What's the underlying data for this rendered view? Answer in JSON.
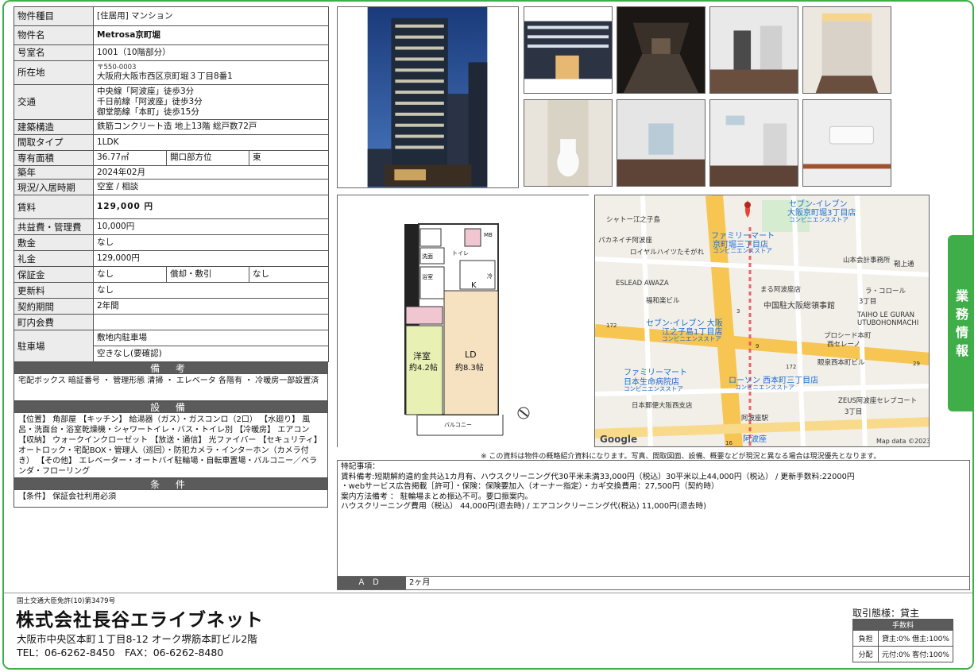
{
  "property": {
    "type_label": "物件種目",
    "type_value": "[住居用] マンション",
    "name_label": "物件名",
    "name_value": "Metrosa京町堀",
    "room_label": "号室名",
    "room_value": "1001（10階部分）",
    "address_label": "所在地",
    "postal": "〒550-0003",
    "address_value": "大阪府大阪市西区京町堀３丁目8番1",
    "transit_label": "交通",
    "transit_lines": [
      "中央線「阿波座」徒歩3分",
      "千日前線「阿波座」徒歩3分",
      "御堂筋線「本町」徒歩15分"
    ],
    "structure_label": "建築構造",
    "structure_value": "鉄筋コンクリート造 地上13階 総戸数72戸",
    "layout_label": "間取タイプ",
    "layout_value": "1LDK",
    "area_label": "専有面積",
    "area_value": "36.77㎡",
    "facing_label": "開口部方位",
    "facing_value": "東",
    "built_label": "築年",
    "built_value": "2024年02月",
    "status_label": "現況/入居時期",
    "status_value": "空室 / 相談",
    "rent_label": "賃料",
    "rent_value": "129,000 円",
    "fee_label": "共益費・管理費",
    "fee_value": "10,000円",
    "deposit_label": "敷金",
    "deposit_value": "なし",
    "key_money_label": "礼金",
    "key_money_value": "129,000円",
    "guarantee_label": "保証金",
    "guarantee_value": "なし",
    "amort_label": "償却・敷引",
    "amort_value": "なし",
    "renewal_label": "更新料",
    "renewal_value": "なし",
    "contract_label": "契約期間",
    "contract_value": "2年間",
    "community_label": "町内会費",
    "community_value": "",
    "parking_label": "駐車場",
    "parking_value_1": "敷地内駐車場",
    "parking_value_2": "空きなし(要確認)"
  },
  "sections": {
    "remarks_title": "備 考",
    "remarks_text": "宅配ボックス 暗証番号 ・ 管理形態 清掃 ・ エレベータ 各階有 ・ 冷暖房一部設置済",
    "facilities_title": "設 備",
    "facilities_text": "【位置】 角部屋 【キッチン】 給湯器（ガス）・ガスコンロ（2口） 【水廻り】 風呂・洗面台・浴室乾燥機・シャワートイレ・バス・トイレ別 【冷暖房】 エアコン 【収納】 ウォークインクローゼット 【放送・通信】 光ファイバー 【セキュリティ】 オートロック・宅配BOX・管理人（巡回）・防犯カメラ・インターホン（カメラ付き） 【その他】 エレベーター・オートバイ駐輪場・自転車置場・バルコニー／ベランダ・フローリング",
    "conditions_title": "条 件",
    "conditions_text": "【条件】 保証会社利用必須"
  },
  "floorplan": {
    "room1": "洋室",
    "room1_size": "約4.2帖",
    "room2": "LD",
    "room2_size": "約8.3帖",
    "kitchen": "K",
    "balcony": "バルコニー",
    "mb": "MB",
    "toilet": "トイレ",
    "washroom": "洗面",
    "bath": "浴室",
    "fridge": "冷"
  },
  "map": {
    "labels": [
      "シャトー江之子島",
      "セブン-イレブン",
      "大阪京町堀3丁目店",
      "コンビニエンスストア",
      "ファミリーマート",
      "京町堀三丁目店",
      "コンビニエンスストア",
      "パカネイチ阿波座",
      "ロイヤルハイツたそがれ",
      "山本会計事務所",
      "靭上通",
      "ESLEAD AWAZA",
      "まる阿波座店",
      "ラ・コロール",
      "3丁目",
      "福和楽ビル",
      "中国駐大阪総領事館",
      "TAIHO LE GURAN",
      "UTUBOHONMACHI",
      "セブン-イレブン 大阪",
      "江之子島1丁目店",
      "コンビニエンスストア",
      "プロシード本町",
      "西セレーノ",
      "眼泉西本町ビル",
      "ファミリーマート",
      "日本生命病院店",
      "コンビニエンスストア",
      "ローソン 西本町三丁目店",
      "コンビニエンスストア",
      "ZEUS阿波座セレブコート",
      "3丁目",
      "日本郵便大阪西支店",
      "阿波座駅",
      "阿波座",
      "Google",
      "Map data ©2023",
      "172",
      "3",
      "9",
      "172",
      "16",
      "29"
    ]
  },
  "notice": "※ この資料は物件の概略紹介資料になります。写真、間取図面、設備、概要などが現況と異なる場合は現況優先となります。",
  "special": {
    "lines": [
      "特記事項：",
      "賃料備考:短期解約違約金共込1カ月有、ハウスクリーニング代30平米未満33,000円（税込）30平米以上44,000円（税込） / 更新手数料:22000円",
      "・webサービス広告掲載［許可］・保険：保険要加入（オーナー指定）・カギ交換費用：27,500円（契約時）",
      "案内方法備考 ： 駐輪場まとめ振込不可。要口振案内。",
      "ハウスクリーニング費用（税込） 44,000円(退去時) / エアコンクリーニング代(税込) 11,000円(退去時)"
    ],
    "ad_label": "ＡＤ",
    "ad_value": "2ヶ月"
  },
  "side_tab": [
    "業",
    "務",
    "情",
    "報"
  ],
  "footer": {
    "license": "国土交通大臣免許(10)第3479号",
    "company": "株式会社長谷エライブネット",
    "address": "大阪市中央区本町１丁目8-12 オーク堺筋本町ビル2階",
    "tel": "TEL：06-6262-8450　FAX：06-6262-8480",
    "deal": "取引態様：貸主",
    "fee_header": "手数料",
    "burden_label": "負担",
    "burden_value": "貸主:0% 借主:100%",
    "split_label": "分配",
    "split_value": "元付:0% 客付:100%"
  },
  "colors": {
    "accent": "#3fae49",
    "header_gray": "#5b5b5b",
    "label_gray": "#ececec"
  }
}
